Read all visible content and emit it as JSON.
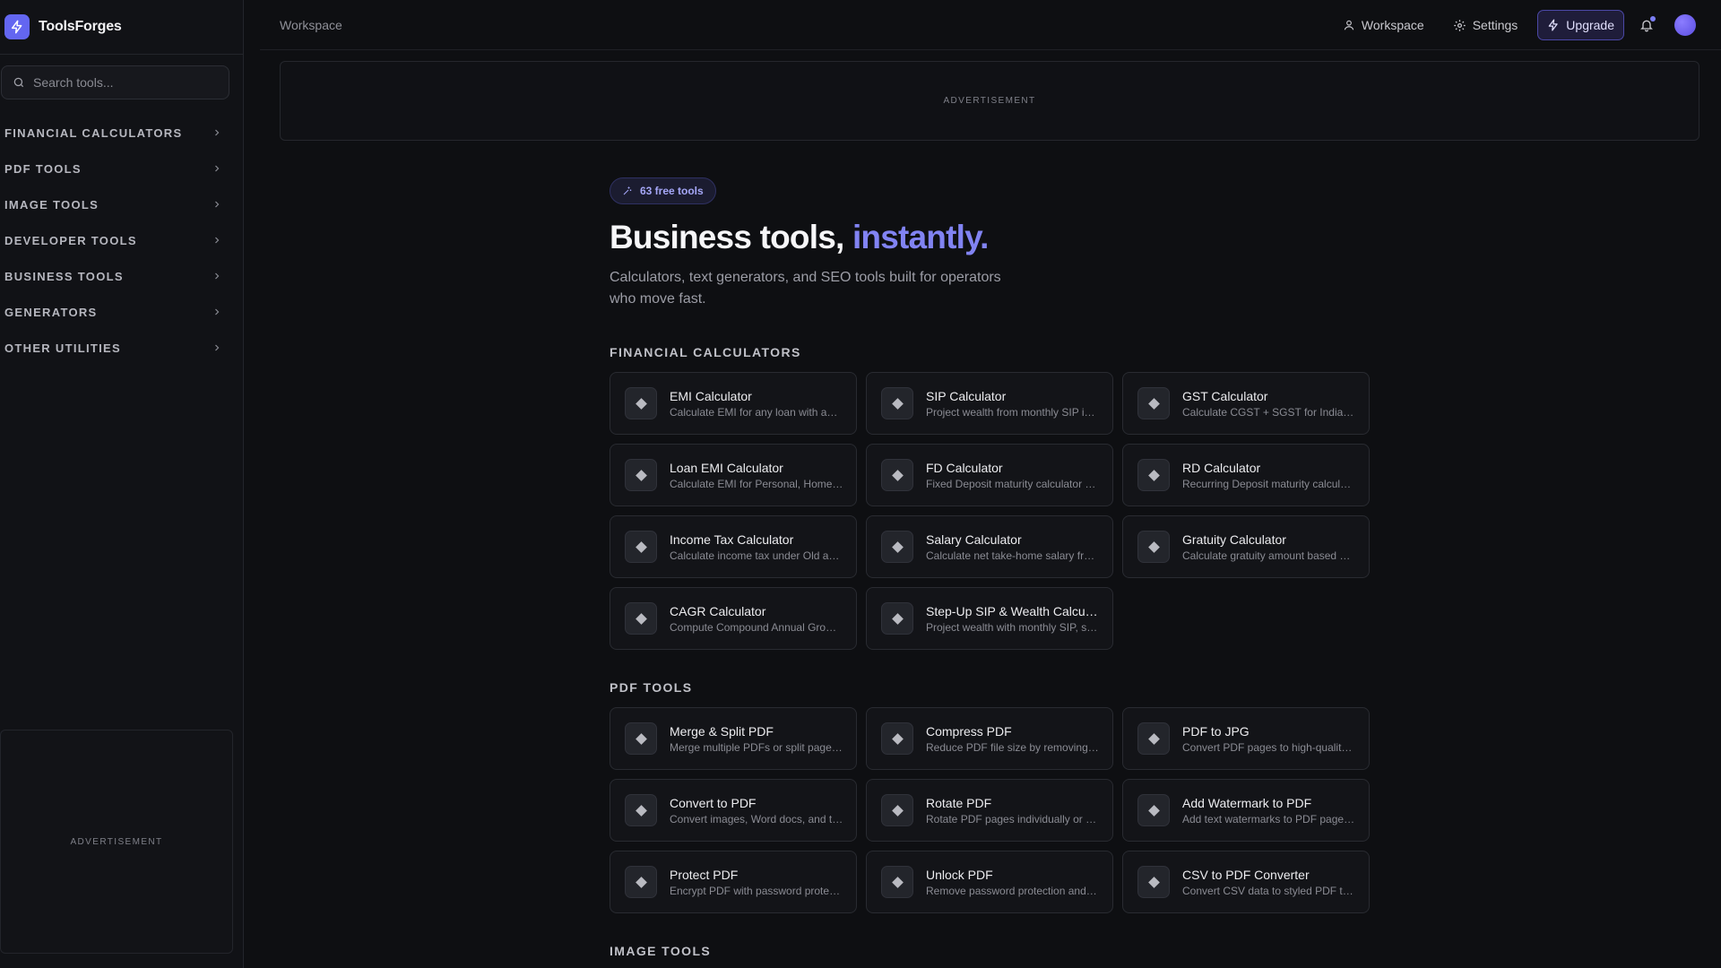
{
  "app": {
    "name": "ToolsForges"
  },
  "search": {
    "placeholder": "Search tools..."
  },
  "sidebar": {
    "items": [
      {
        "label": "FINANCIAL CALCULATORS"
      },
      {
        "label": "PDF TOOLS"
      },
      {
        "label": "IMAGE TOOLS"
      },
      {
        "label": "DEVELOPER TOOLS"
      },
      {
        "label": "BUSINESS TOOLS"
      },
      {
        "label": "GENERATORS"
      },
      {
        "label": "OTHER UTILITIES"
      }
    ],
    "ad_label": "ADVERTISEMENT"
  },
  "header": {
    "breadcrumb": "Workspace",
    "workspace_label": "Workspace",
    "settings_label": "Settings",
    "upgrade_label": "Upgrade"
  },
  "banner": {
    "ad_label": "ADVERTISEMENT"
  },
  "hero": {
    "badge": "63 free tools",
    "title_main": "Business tools, ",
    "title_accent": "instantly.",
    "subtitle": "Calculators, text generators, and SEO tools built for operators who move fast."
  },
  "sections": [
    {
      "title": "FINANCIAL CALCULATORS",
      "tools": [
        {
          "name": "EMI Calculator",
          "desc": "Calculate EMI for any loan with a…"
        },
        {
          "name": "SIP Calculator",
          "desc": "Project wealth from monthly SIP i…"
        },
        {
          "name": "GST Calculator",
          "desc": "Calculate CGST + SGST for India…"
        },
        {
          "name": "Loan EMI Calculator",
          "desc": "Calculate EMI for Personal, Home…"
        },
        {
          "name": "FD Calculator",
          "desc": "Fixed Deposit maturity calculator …"
        },
        {
          "name": "RD Calculator",
          "desc": "Recurring Deposit maturity calcul…"
        },
        {
          "name": "Income Tax Calculator",
          "desc": "Calculate income tax under Old a…"
        },
        {
          "name": "Salary Calculator",
          "desc": "Calculate net take-home salary fr…"
        },
        {
          "name": "Gratuity Calculator",
          "desc": "Calculate gratuity amount based …"
        },
        {
          "name": "CAGR Calculator",
          "desc": "Compute Compound Annual Gro…"
        },
        {
          "name": "Step-Up SIP & Wealth Calcu…",
          "desc": "Project wealth with monthly SIP, s…"
        }
      ]
    },
    {
      "title": "PDF TOOLS",
      "tools": [
        {
          "name": "Merge & Split PDF",
          "desc": "Merge multiple PDFs or split page…"
        },
        {
          "name": "Compress PDF",
          "desc": "Reduce PDF file size by removing…"
        },
        {
          "name": "PDF to JPG",
          "desc": "Convert PDF pages to high-qualit…"
        },
        {
          "name": "Convert to PDF",
          "desc": "Convert images, Word docs, and t…"
        },
        {
          "name": "Rotate PDF",
          "desc": "Rotate PDF pages individually or …"
        },
        {
          "name": "Add Watermark to PDF",
          "desc": "Add text watermarks to PDF page…"
        },
        {
          "name": "Protect PDF",
          "desc": "Encrypt PDF with password prote…"
        },
        {
          "name": "Unlock PDF",
          "desc": "Remove password protection and…"
        },
        {
          "name": "CSV to PDF Converter",
          "desc": "Convert CSV data to styled PDF t…"
        }
      ]
    },
    {
      "title": "IMAGE TOOLS",
      "tools": []
    }
  ]
}
